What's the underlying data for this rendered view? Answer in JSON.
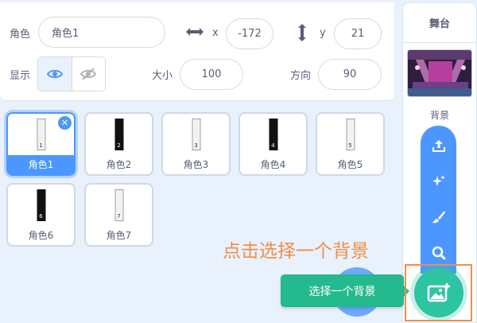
{
  "sprite_info": {
    "sprite_label": "角色",
    "sprite_name": "角色1",
    "x_label": "x",
    "x_value": "-172",
    "y_label": "y",
    "y_value": "21",
    "show_label": "显示",
    "size_label": "大小",
    "size_value": "100",
    "direction_label": "方向",
    "direction_value": "90"
  },
  "sprites": [
    {
      "name": "角色1",
      "num": "1",
      "dark": false,
      "selected": true
    },
    {
      "name": "角色2",
      "num": "2",
      "dark": true,
      "selected": false
    },
    {
      "name": "角色3",
      "num": "3",
      "dark": false,
      "selected": false
    },
    {
      "name": "角色4",
      "num": "4",
      "dark": true,
      "selected": false
    },
    {
      "name": "角色5",
      "num": "5",
      "dark": false,
      "selected": false
    },
    {
      "name": "角色6",
      "num": "6",
      "dark": true,
      "selected": false
    },
    {
      "name": "角色7",
      "num": "7",
      "dark": false,
      "selected": false
    }
  ],
  "stage": {
    "header": "舞台",
    "backdrop_label": "背景"
  },
  "tooltip": "选择一个背景",
  "annotation": "点击选择一个背景",
  "colors": {
    "accent": "#4c97ff",
    "green": "#2dc4a2",
    "annotation": "#f08e47"
  }
}
